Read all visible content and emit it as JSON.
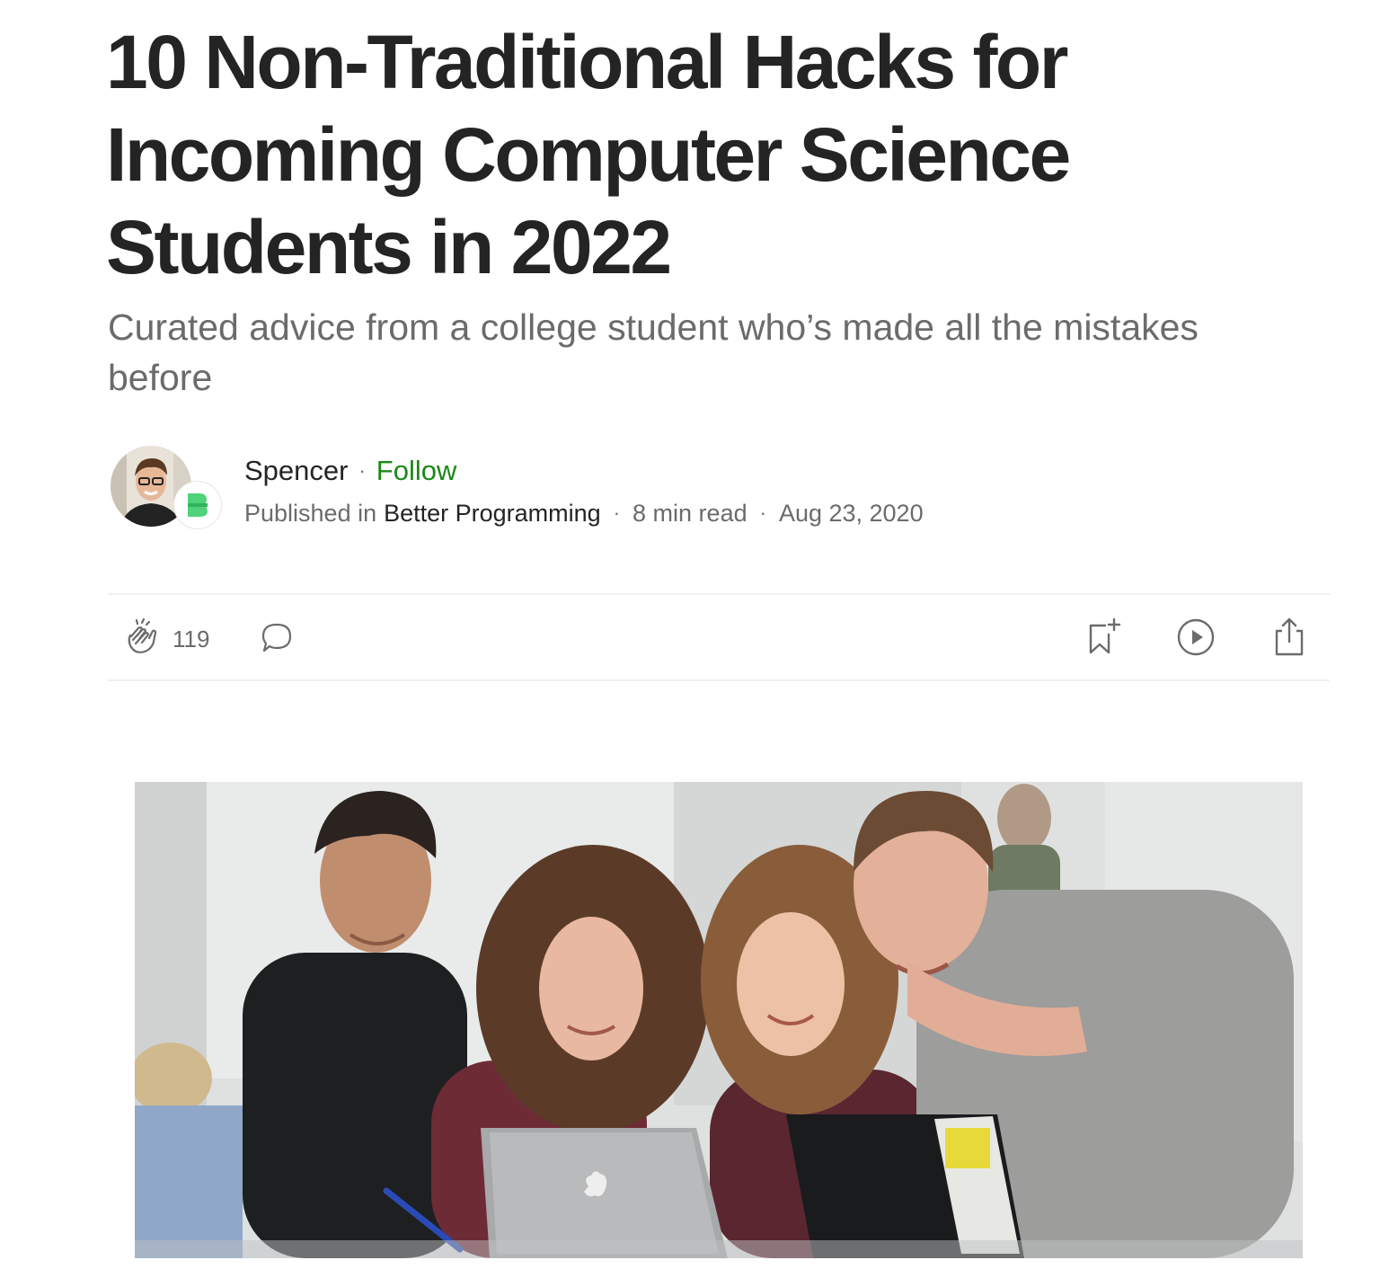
{
  "article": {
    "title": "10 Non-Traditional Hacks for Incoming Computer Science Students in 2022",
    "subtitle": "Curated advice from a college student who’s made all the mistakes before"
  },
  "author": {
    "name": "Spencer",
    "dot": "·",
    "follow_label": "Follow",
    "published_in_label": "Published in",
    "publication": "Better Programming",
    "read_time": "8 min read",
    "date": "Aug 23, 2020",
    "separator": "·"
  },
  "actions": {
    "clap_count": "119",
    "icons": [
      "clap-icon",
      "comment-icon",
      "bookmark-add-icon",
      "listen-play-icon",
      "share-icon"
    ]
  },
  "colors": {
    "text": "#242424",
    "muted": "#6b6b6b",
    "follow": "#1a8917",
    "divider": "#f0f0f0",
    "publication_badge": "#4fd27a"
  }
}
